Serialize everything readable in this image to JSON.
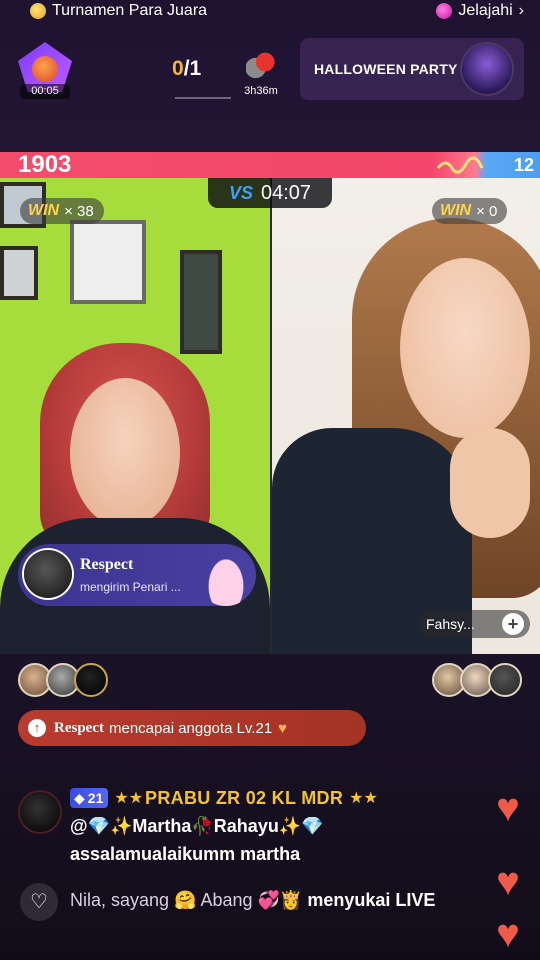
{
  "topbar": {
    "tournament_label": "Turnamen Para Juara",
    "explore_label": "Jelajahi",
    "chevron_icon": "chevron-right-icon"
  },
  "header": {
    "timer": "00:05",
    "score_current": "0",
    "score_total": "/1",
    "gift_timer": "3h36m",
    "event_label": "HALLOWEEN PARTY"
  },
  "battle": {
    "left_score": "1903",
    "right_score": "12",
    "countdown": "04:07",
    "vs_label": "VS",
    "left_win_label": "WIN",
    "left_win_count": "× 38",
    "right_win_label": "WIN",
    "right_win_count": "× 0",
    "colors": {
      "left": "#f44d6b",
      "right": "#4d9ef2"
    }
  },
  "gift_card": {
    "name": "Respect",
    "subtitle": "mengirim Penari ..."
  },
  "right_host": {
    "name": "Fahsy...",
    "follow_icon": "plus-icon"
  },
  "announcement": {
    "who": "Respect",
    "text": "mencapai anggota Lv.21",
    "icon": "heart-icon"
  },
  "comment": {
    "level": "21",
    "stars": "★★",
    "username": "PRABU ZR 02 KL MDR",
    "stars_after": "★★",
    "line2": "@💎✨Martha🥀Rahayu✨💎",
    "line3": "assalamualaikumm martha"
  },
  "likes": {
    "text": "Nila, sayang 🤗 Abang 💞👸",
    "action": "menyukai LIVE"
  }
}
